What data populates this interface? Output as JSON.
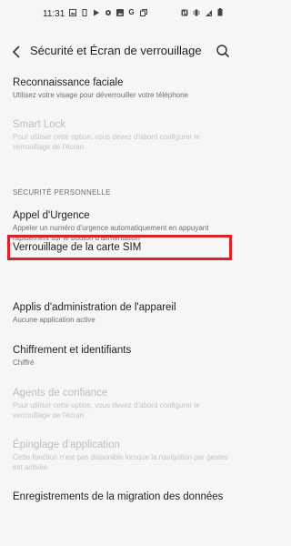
{
  "status_bar": {
    "time": "11:31",
    "left_icons": [
      "photo-icon",
      "vibrate-icon",
      "play-store-icon",
      "gear-icon",
      "image-icon",
      "google-icon",
      "copy-icon"
    ],
    "right_icons": [
      "nfc-icon",
      "vibrate-icon",
      "mute-icon",
      "battery-icon"
    ]
  },
  "toolbar": {
    "title": "Sécurité et Écran de verrouillage"
  },
  "items": {
    "facial": {
      "title": "Reconnaissance faciale",
      "subtitle": "Utilisez votre visage pour déverrouiller votre téléphone"
    },
    "smart_lock": {
      "title": "Smart Lock",
      "subtitle": "Pour utiliser cette option, vous devez d'abord configurer le verrouillage de l'écran"
    },
    "section_personal": "SÉCURITÉ PERSONNELLE",
    "emergency": {
      "title": "Appel d'Urgence",
      "subtitle": "Appeler un numéro d'urgence automatiquement en appuyant rapidement sur le bouton d'alimentation"
    },
    "sim_lock": {
      "title": "Verrouillage de la carte SIM"
    },
    "device_admin": {
      "title": "Applis d'administration de l'appareil",
      "subtitle": "Aucune application active"
    },
    "encryption": {
      "title": "Chiffrement et identifiants",
      "subtitle": "Chiffré"
    },
    "trust_agents": {
      "title": "Agents de confiance",
      "subtitle": "Pour utiliser cette option, vous devez d'abord configurer le verrouillage de l'écran"
    },
    "pinning": {
      "title": "Épinglage d'application",
      "subtitle": "Cette fonction n'est pas disponible lorsque la navigation par gestes est activée."
    },
    "migration": {
      "title": "Enregistrements de la migration des données"
    }
  },
  "colors": {
    "highlight": "#d8232a",
    "background": "#f6f6f6"
  }
}
